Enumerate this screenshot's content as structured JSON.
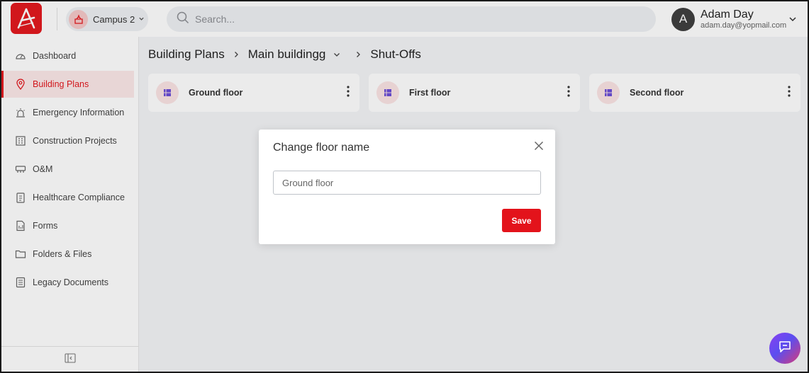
{
  "topbar": {
    "campus_label": "Campus 2",
    "search_placeholder": "Search...",
    "user_initial": "A",
    "user_name": "Adam Day",
    "user_email": "adam.day@yopmail.com"
  },
  "sidebar": {
    "items": [
      {
        "label": "Dashboard",
        "icon": "dashboard-gauge-icon",
        "active": false
      },
      {
        "label": "Building Plans",
        "icon": "location-pin-icon",
        "active": true
      },
      {
        "label": "Emergency Information",
        "icon": "alarm-light-icon",
        "active": false
      },
      {
        "label": "Construction Projects",
        "icon": "building-icon",
        "active": false
      },
      {
        "label": "O&M",
        "icon": "hvac-unit-icon",
        "active": false
      },
      {
        "label": "Healthcare Compliance",
        "icon": "clipboard-icon",
        "active": false
      },
      {
        "label": "Forms",
        "icon": "form-icon",
        "active": false
      },
      {
        "label": "Folders & Files",
        "icon": "folder-icon",
        "active": false
      },
      {
        "label": "Legacy Documents",
        "icon": "documents-icon",
        "active": false
      }
    ],
    "collapse_icon": "sidebar-collapse-icon"
  },
  "breadcrumb": {
    "level1": "Building Plans",
    "level2": "Main buildingg",
    "level3": "Shut-Offs"
  },
  "floors": [
    {
      "name": "Ground floor"
    },
    {
      "name": "First floor"
    },
    {
      "name": "Second floor"
    }
  ],
  "modal": {
    "title": "Change floor name",
    "input_value": "Ground floor",
    "save_label": "Save"
  },
  "colors": {
    "brand_red": "#e3191f",
    "active_bg": "#fce9e9",
    "save_red": "#e3131b"
  }
}
